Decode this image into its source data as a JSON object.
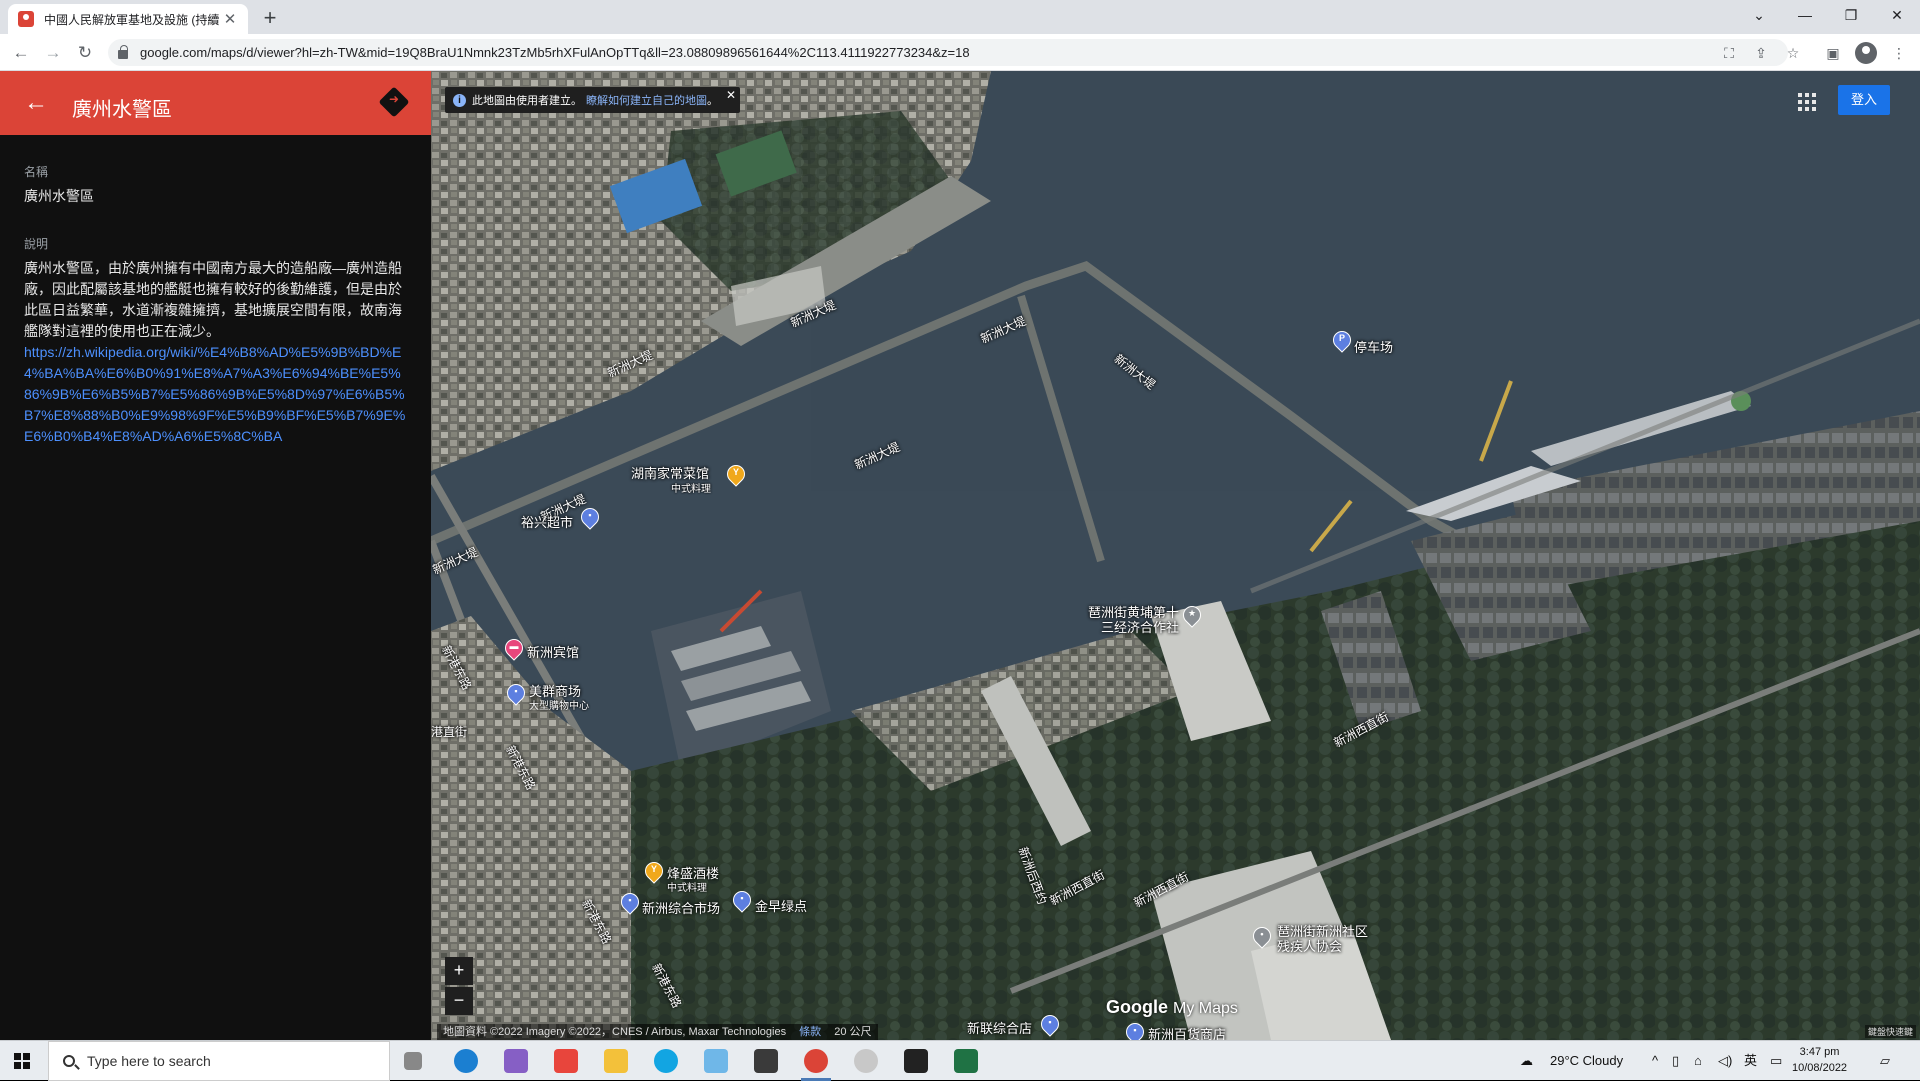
{
  "browser": {
    "tab_title": "中國人民解放軍基地及設施 (持續",
    "url": "google.com/maps/d/viewer?hl=zh-TW&mid=19Q8BraU1Nmnk23TzMb5rhXFulAnOpTTq&ll=23.08809896561644%2C113.4111922773234&z=18"
  },
  "panel": {
    "title": "廣州水警區",
    "name_label": "名稱",
    "name_value": "廣州水警區",
    "desc_label": "說明",
    "desc_text": "廣州水警區，由於廣州擁有中國南方最大的造船廠—廣州造船廠，因此配屬該基地的艦艇也擁有較好的後勤維護，但是由於此區日益繁華，水道漸複雜擁擠，基地擴展空間有限，故南海艦隊對這裡的使用也正在減少。",
    "desc_link": "https://zh.wikipedia.org/wiki/%E4%B8%AD%E5%9B%BD%E4%BA%BA%E6%B0%91%E8%A7%A3%E6%94%BE%E5%86%9B%E6%B5%B7%E5%86%9B%E5%8D%97%E6%B5%B7%E8%88%B0%E9%98%9F%E5%B9%BF%E5%B7%9E%E6%B0%B4%E8%AD%A6%E5%8C%BA"
  },
  "map": {
    "banner_text": "此地圖由使用者建立。",
    "banner_link": "瞭解如何建立自己的地圖",
    "banner_end": "。",
    "signin_label": "登入",
    "zoom_in": "+",
    "zoom_out": "−",
    "attribution": "地圖資料 ©2022 Imagery ©2022，CNES / Airbus, Maxar Technologies",
    "terms": "條款",
    "scale": "20 公尺",
    "logo_google": "Google",
    "logo_mymaps": "My Maps",
    "shortcut": "鍵盤快速鍵",
    "watermark": "© 2022 Google",
    "labels": {
      "hunan_restaurant": "湖南家常菜馆",
      "hunan_sub": "中式料理",
      "yuxing": "裕兴超市",
      "xinzhou_hotel": "新洲宾馆",
      "meiqun": "美群商场",
      "meiqun_sub": "大型購物中心",
      "parking": "停车场",
      "coop": "琶洲街黄埔第十三经济合作社",
      "fengsheng": "烽盛酒楼",
      "fengsheng_sub": "中式料理",
      "market": "新洲综合市场",
      "jinzao": "金早绿点",
      "disabled_assoc": "琶洲街新洲社区残疾人协会",
      "xinlian": "新联综合店",
      "department": "新洲百货商店"
    },
    "roads": {
      "dike": "新洲大堤",
      "east_road": "新港东路",
      "west_street": "新洲西直街",
      "zhi_street": "新洲后西约",
      "zhijie": "港直街"
    }
  },
  "taskbar": {
    "search_placeholder": "Type here to search",
    "weather": "29°C  Cloudy",
    "ime": "英",
    "time": "3:47 pm",
    "date": "10/08/2022"
  }
}
